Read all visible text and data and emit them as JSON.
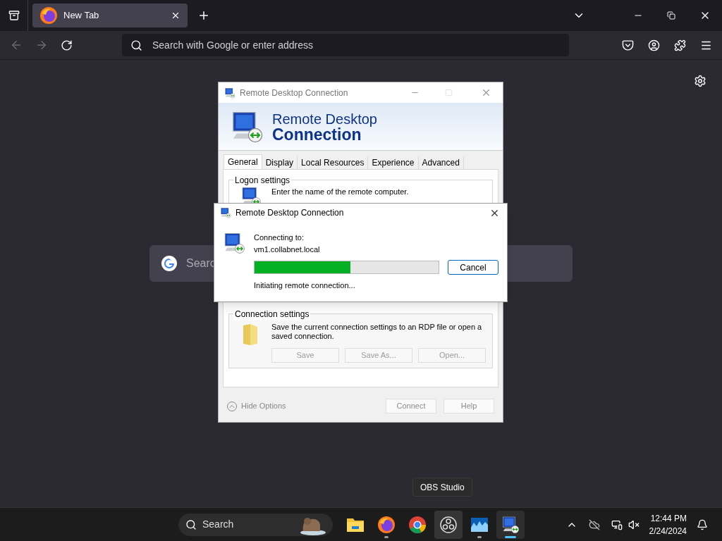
{
  "browser": {
    "tabs": [
      {
        "title": "New Tab",
        "selected": true
      }
    ],
    "address_placeholder": "Search with Google or enter address",
    "page_search_placeholder": "Searc"
  },
  "rdp_window": {
    "title": "Remote Desktop Connection",
    "banner_line_1": "Remote Desktop",
    "banner_line_2": "Connection",
    "tabs": [
      {
        "label": "General",
        "selected": true
      },
      {
        "label": "Display",
        "selected": false
      },
      {
        "label": "Local Resources",
        "selected": false
      },
      {
        "label": "Experience",
        "selected": false
      },
      {
        "label": "Advanced",
        "selected": false
      }
    ],
    "logon_group": {
      "label": "Logon settings",
      "text": "Enter the name of the remote computer."
    },
    "connection_group": {
      "label": "Connection settings",
      "text": "Save the current connection settings to an RDP file or open a saved connection.",
      "buttons": [
        {
          "label": "Save",
          "disabled": true
        },
        {
          "label": "Save As...",
          "disabled": true
        },
        {
          "label": "Open...",
          "disabled": true
        }
      ]
    },
    "hide_options": "Hide Options",
    "footer_buttons": [
      {
        "label": "Connect",
        "disabled": true
      },
      {
        "label": "Help",
        "disabled": true
      }
    ]
  },
  "connecting_dialog": {
    "title": "Remote Desktop Connection",
    "connecting_label": "Connecting to:",
    "host": "vm1.collabnet.local",
    "progress": {
      "level": 0.52
    },
    "status": "Initiating remote connection...",
    "cancel": "Cancel"
  },
  "tooltip": "OBS Studio",
  "taskbar": {
    "search_placeholder": "Search",
    "apps": [
      {
        "kind": "folder",
        "running": false,
        "active": false,
        "hovered": false
      },
      {
        "kind": "firefox",
        "running": true,
        "active": false,
        "hovered": false
      },
      {
        "kind": "chrome",
        "running": false,
        "active": false,
        "hovered": false
      },
      {
        "kind": "obs",
        "running": false,
        "active": false,
        "hovered": true
      },
      {
        "kind": "monitor",
        "running": true,
        "active": false,
        "hovered": false
      },
      {
        "kind": "rdp",
        "running": true,
        "active": true,
        "hovered": false
      }
    ],
    "time": "12:44 PM",
    "date": "2/24/2024"
  }
}
